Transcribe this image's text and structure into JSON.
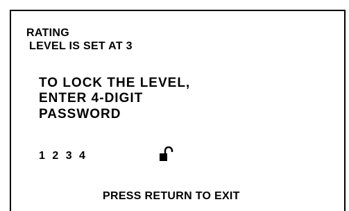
{
  "rating": {
    "title": "RATING",
    "level_text": "LEVEL IS SET AT 3"
  },
  "instructions": {
    "line1": "TO LOCK THE LEVEL,",
    "line2": "ENTER 4-DIGIT",
    "line3": "PASSWORD"
  },
  "password": {
    "value": "1 2 3 4",
    "lock_icon": "unlocked-padlock-icon"
  },
  "footer": {
    "exit_text": "PRESS RETURN TO EXIT"
  },
  "colors": {
    "background": "#ffffff",
    "foreground": "#000000"
  }
}
